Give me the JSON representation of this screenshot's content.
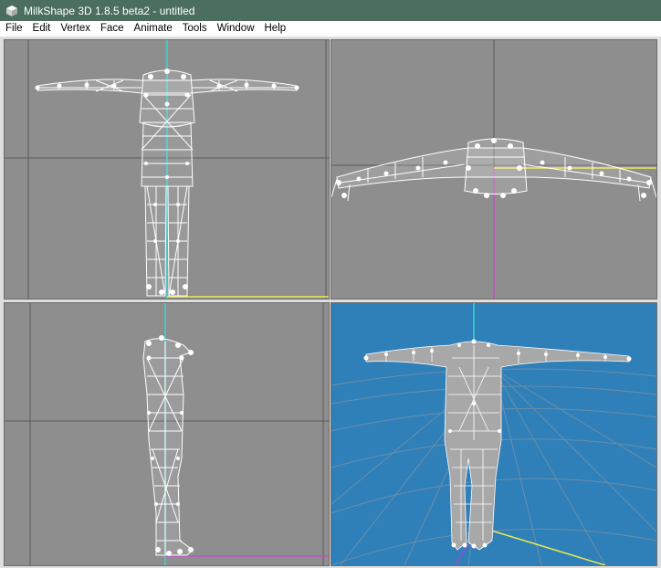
{
  "window": {
    "title": "MilkShape 3D 1.8.5 beta2 - untitled",
    "app_icon": "milkshape-cube-icon"
  },
  "menu": [
    {
      "label": "File"
    },
    {
      "label": "Edit"
    },
    {
      "label": "Vertex"
    },
    {
      "label": "Face"
    },
    {
      "label": "Animate"
    },
    {
      "label": "Tools"
    },
    {
      "label": "Window"
    },
    {
      "label": "Help"
    }
  ],
  "viewports": [
    {
      "id": "front",
      "view": "front wireframe"
    },
    {
      "id": "top",
      "view": "top wireframe"
    },
    {
      "id": "side",
      "view": "side wireframe"
    },
    {
      "id": "perspective",
      "view": "3d shaded"
    }
  ],
  "colors": {
    "titlebar": "#4b6e5e",
    "viewport_bg": "#8e8e8e",
    "perspective_bg": "#2f7fb9",
    "axis_cyan": "#36d6d6",
    "axis_yellow": "#e8e850",
    "axis_magenta": "#c050c0",
    "mesh": "#ffffff",
    "grid": "#5a5a5a"
  }
}
